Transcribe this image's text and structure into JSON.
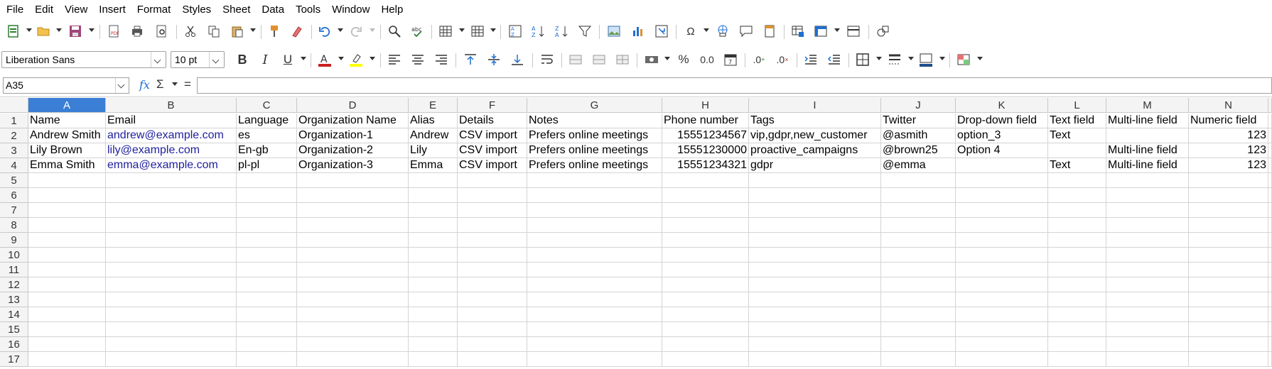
{
  "menu": [
    "File",
    "Edit",
    "View",
    "Insert",
    "Format",
    "Styles",
    "Sheet",
    "Data",
    "Tools",
    "Window",
    "Help"
  ],
  "font": {
    "name": "Liberation Sans",
    "size": "10 pt"
  },
  "namebox": "A35",
  "formula": {
    "fx": "fx",
    "sum": "Σ",
    "eq": "="
  },
  "columns": [
    "A",
    "B",
    "C",
    "D",
    "E",
    "F",
    "G",
    "H",
    "I",
    "J",
    "K",
    "L",
    "M",
    "N"
  ],
  "rows": [
    "1",
    "2",
    "3",
    "4",
    "5",
    "6",
    "7",
    "8",
    "9",
    "10",
    "11",
    "12",
    "13",
    "14",
    "15",
    "16",
    "17"
  ],
  "cells": [
    [
      "Name",
      "Email",
      "Language",
      "Organization Name",
      "Alias",
      "Details",
      "Notes",
      "Phone number",
      "Tags",
      "Twitter",
      "Drop-down field",
      "Text field",
      "Multi-line field",
      "Numeric field"
    ],
    [
      "Andrew Smith",
      "andrew@example.com",
      "es",
      "Organization-1",
      "Andrew",
      "CSV import",
      "Prefers online meetings",
      "15551234567",
      "vip,gdpr,new_customer",
      "@asmith",
      "option_3",
      "Text",
      "",
      "123"
    ],
    [
      "Lily Brown",
      "lily@example.com",
      "En-gb",
      "Organization-2",
      "Lily",
      "CSV import",
      "Prefers online meetings",
      "15551230000",
      "proactive_campaigns",
      "@brown25",
      "Option 4",
      "",
      "Multi-line field",
      "123"
    ],
    [
      "Emma Smith",
      "emma@example.com",
      "pl-pl",
      "Organization-3",
      "Emma",
      "CSV import",
      "Prefers online meetings",
      "15551234321",
      "gdpr",
      "@emma",
      "",
      "Text",
      "Multi-line field",
      "123"
    ]
  ],
  "colors": {
    "selected_header": "#3a7fd5",
    "link": "#1f1f9f",
    "font_color": "#c9211e",
    "highlight": "#ffff00"
  }
}
